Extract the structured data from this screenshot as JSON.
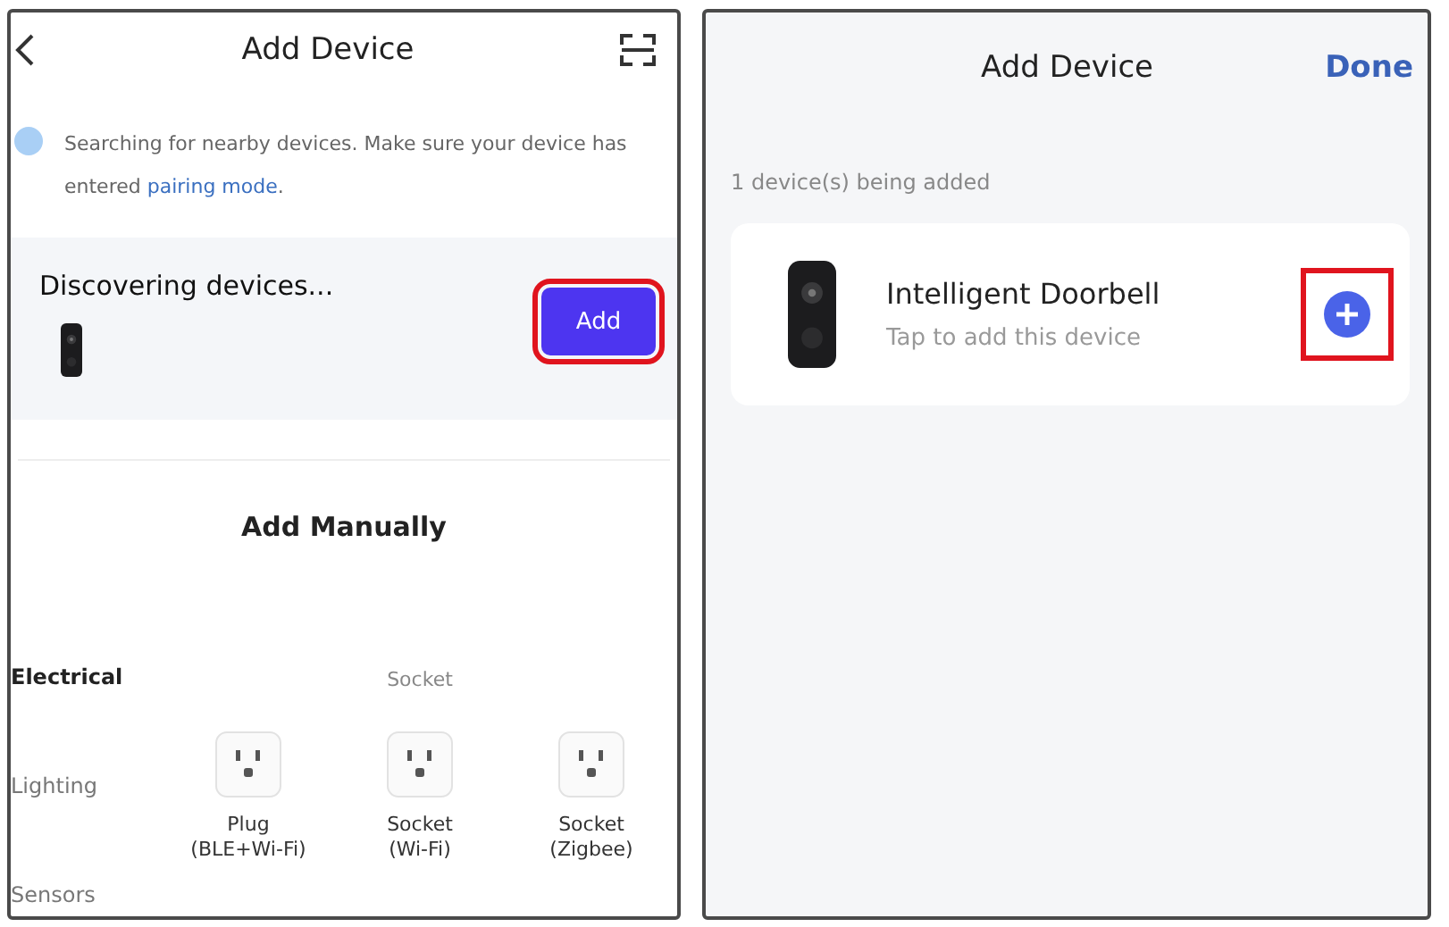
{
  "screens": [
    {
      "kind": "search",
      "title": "Add Device",
      "notice": "Searching for nearby devices. Make sure your device has entered ",
      "notice_link": "pairing mode",
      "notice_end": ".",
      "discovery": {
        "title": "Discovering devices...",
        "button": "Add",
        "highlighted": true
      },
      "manual_title": "Add Manually",
      "categories": [
        {
          "label": "Electrical",
          "selected": true
        },
        {
          "label": "Lighting",
          "selected": false
        },
        {
          "label": "Sensors",
          "selected": false
        }
      ],
      "section": "Socket",
      "devices": [
        {
          "label": "Plug\n(BLE+Wi-Fi)"
        },
        {
          "label": "Socket\n(Wi-Fi)"
        },
        {
          "label": "Socket\n(Zigbee)"
        }
      ]
    },
    {
      "kind": "found",
      "title": "Add Device",
      "action": "Done",
      "count_text": "1 device(s) being added",
      "found": [
        {
          "name": "Intelligent Doorbell",
          "hint": "Tap to add this device",
          "highlighted": true
        }
      ]
    }
  ]
}
